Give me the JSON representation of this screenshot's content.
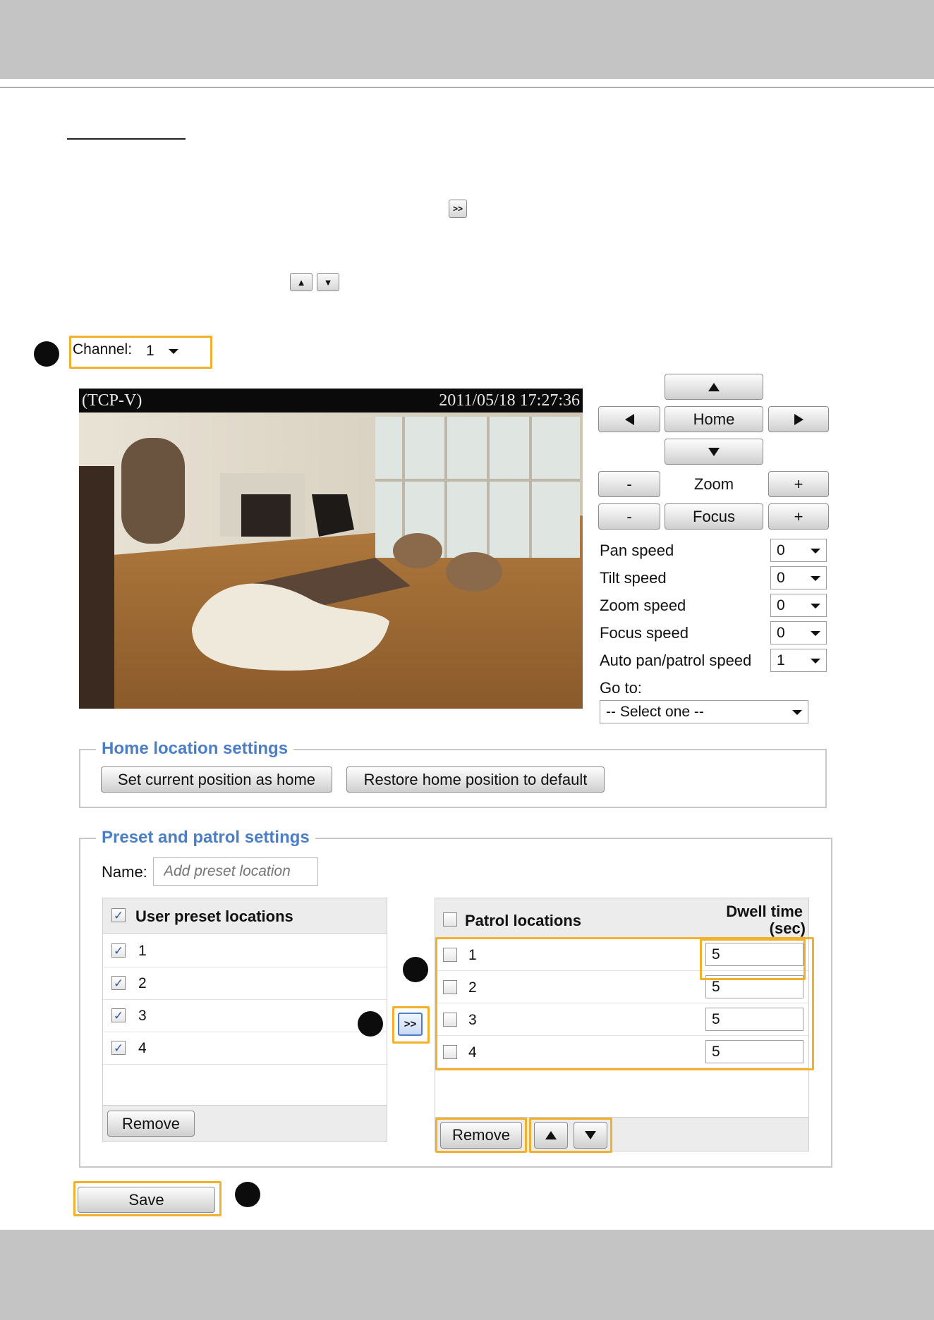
{
  "toolbar_icons": {
    "inline_add_label": ">>",
    "inline_up_label": "▲",
    "inline_down_label": "▼"
  },
  "channel": {
    "label": "Channel:",
    "value": "1"
  },
  "video": {
    "protocol": "(TCP-V)",
    "timestamp": "2011/05/18 17:27:36"
  },
  "ptz": {
    "home_label": "Home",
    "zoom_label": "Zoom",
    "focus_label": "Focus",
    "minus_label": "-",
    "plus_label": "+",
    "speeds": [
      {
        "label": "Pan speed",
        "value": "0"
      },
      {
        "label": "Tilt speed",
        "value": "0"
      },
      {
        "label": "Zoom speed",
        "value": "0"
      },
      {
        "label": "Focus speed",
        "value": "0"
      },
      {
        "label": "Auto pan/patrol speed",
        "value": "1"
      }
    ],
    "goto_label": "Go to:",
    "goto_value": "-- Select one --"
  },
  "home_settings": {
    "legend": "Home location settings",
    "set_home": "Set current position as home",
    "restore_home": "Restore home position to default"
  },
  "preset_settings": {
    "legend": "Preset and patrol settings",
    "name_label": "Name:",
    "name_placeholder": "Add preset location",
    "user_presets_header": "User preset locations",
    "user_presets": [
      "1",
      "2",
      "3",
      "4"
    ],
    "remove_label": "Remove",
    "add_label": ">>",
    "patrol_header": "Patrol locations",
    "dwell_header_line1": "Dwell time",
    "dwell_header_line2": "(sec)",
    "patrol": [
      {
        "name": "1",
        "dwell": "5"
      },
      {
        "name": "2",
        "dwell": "5"
      },
      {
        "name": "3",
        "dwell": "5"
      },
      {
        "name": "4",
        "dwell": "5"
      }
    ],
    "patrol_remove_label": "Remove",
    "up_label": "▲",
    "down_label": "▼"
  },
  "save_label": "Save",
  "colors": {
    "legend": "#4a7fc7",
    "highlight": "#f3b12b",
    "header_bar": "#c4c4c4"
  }
}
